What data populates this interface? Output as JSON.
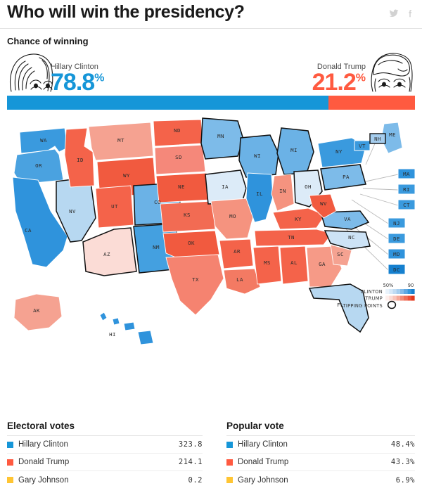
{
  "header": {
    "title": "Who will win the presidency?",
    "social": [
      {
        "name": "twitter-icon",
        "label": "Twitter"
      },
      {
        "name": "facebook-icon",
        "label": "Facebook"
      }
    ]
  },
  "chance": {
    "label": "Chance of winning",
    "clinton": {
      "name": "Hillary Clinton",
      "value": "78.8",
      "symbol": "%",
      "pct": 78.8,
      "color": "#1696d8"
    },
    "trump": {
      "name": "Donald Trump",
      "value": "21.2",
      "symbol": "%",
      "pct": 21.2,
      "color": "#ff5a40"
    }
  },
  "legend": {
    "scale_low": "50%",
    "scale_high": "90",
    "clinton_label": "CLINTON",
    "trump_label": "TRUMP",
    "tipping_label": "TIPPING POINTS",
    "clinton_ramp": [
      "#eaf3fb",
      "#d7e9f8",
      "#c0dcf3",
      "#a5cdee",
      "#84bbe8",
      "#5fa8e2",
      "#3596db",
      "#1680cf"
    ],
    "trump_ramp": [
      "#fdeeeb",
      "#fbdcd6",
      "#f9c5bb",
      "#f6a998",
      "#f38b77",
      "#f06f57",
      "#ed5138",
      "#e3381c"
    ]
  },
  "map": {
    "tipping_states": [
      "NV",
      "CO",
      "IA",
      "OH",
      "NC",
      "PA",
      "FL",
      "MN",
      "WI",
      "NH",
      "NM",
      "MI",
      "VA",
      "AZ"
    ],
    "states": [
      {
        "code": "WA",
        "color": "#3a9ade"
      },
      {
        "code": "OR",
        "color": "#4aa2e0"
      },
      {
        "code": "CA",
        "color": "#2f93dc"
      },
      {
        "code": "NV",
        "color": "#b7d8f1"
      },
      {
        "code": "ID",
        "color": "#f4634a"
      },
      {
        "code": "MT",
        "color": "#f5a291"
      },
      {
        "code": "WY",
        "color": "#f15a3f"
      },
      {
        "code": "UT",
        "color": "#f4634a"
      },
      {
        "code": "AZ",
        "color": "#fbdcd6"
      },
      {
        "code": "NM",
        "color": "#44a0e0"
      },
      {
        "code": "CO",
        "color": "#6bb2e6"
      },
      {
        "code": "ND",
        "color": "#f4634a"
      },
      {
        "code": "SD",
        "color": "#f5887a"
      },
      {
        "code": "NE",
        "color": "#f15a3f"
      },
      {
        "code": "KS",
        "color": "#f26b53"
      },
      {
        "code": "OK",
        "color": "#f15a3f"
      },
      {
        "code": "TX",
        "color": "#f58370"
      },
      {
        "code": "MN",
        "color": "#7dbbe9"
      },
      {
        "code": "IA",
        "color": "#dcebf8"
      },
      {
        "code": "MO",
        "color": "#f5937f"
      },
      {
        "code": "AR",
        "color": "#f4634a"
      },
      {
        "code": "LA",
        "color": "#f37a63"
      },
      {
        "code": "WI",
        "color": "#6bb2e6"
      },
      {
        "code": "IL",
        "color": "#2f93dc"
      },
      {
        "code": "MI",
        "color": "#6bb2e6"
      },
      {
        "code": "IN",
        "color": "#f5937f"
      },
      {
        "code": "OH",
        "color": "#dcebf8"
      },
      {
        "code": "KY",
        "color": "#f4634a"
      },
      {
        "code": "TN",
        "color": "#f4634a"
      },
      {
        "code": "MS",
        "color": "#f4634a"
      },
      {
        "code": "AL",
        "color": "#f4634a"
      },
      {
        "code": "GA",
        "color": "#f69a87"
      },
      {
        "code": "FL",
        "color": "#b7d8f1"
      },
      {
        "code": "SC",
        "color": "#f5a291"
      },
      {
        "code": "NC",
        "color": "#cde3f6"
      },
      {
        "code": "VA",
        "color": "#7dbbe9"
      },
      {
        "code": "WV",
        "color": "#f15a3f"
      },
      {
        "code": "PA",
        "color": "#7dbbe9"
      },
      {
        "code": "NY",
        "color": "#3a9ade"
      },
      {
        "code": "ME",
        "color": "#7dbbe9"
      },
      {
        "code": "AK",
        "color": "#f5a291"
      },
      {
        "code": "HI",
        "color": "#2f93dc"
      }
    ],
    "boxes": [
      {
        "code": "VT",
        "color": "#3a9ade"
      },
      {
        "code": "NH",
        "color": "#a5cdee"
      },
      {
        "code": "MA",
        "color": "#2f93dc"
      },
      {
        "code": "RI",
        "color": "#3a9ade"
      },
      {
        "code": "CT",
        "color": "#3a9ade"
      },
      {
        "code": "NJ",
        "color": "#3a9ade"
      },
      {
        "code": "DE",
        "color": "#3a9ade"
      },
      {
        "code": "MD",
        "color": "#2f93dc"
      },
      {
        "code": "DC",
        "color": "#1680cf"
      }
    ]
  },
  "electoral": {
    "title": "Electoral votes",
    "rows": [
      {
        "name": "Hillary Clinton",
        "value": "323.8",
        "color": "#1696d8"
      },
      {
        "name": "Donald Trump",
        "value": "214.1",
        "color": "#ff5a40"
      },
      {
        "name": "Gary Johnson",
        "value": "0.2",
        "color": "#ffc533"
      }
    ]
  },
  "popular": {
    "title": "Popular vote",
    "rows": [
      {
        "name": "Hillary Clinton",
        "value": "48.4%",
        "color": "#1696d8"
      },
      {
        "name": "Donald Trump",
        "value": "43.3%",
        "color": "#ff5a40"
      },
      {
        "name": "Gary Johnson",
        "value": "6.9%",
        "color": "#ffc533"
      }
    ]
  },
  "chart_data": {
    "type": "map",
    "title": "Who will win the presidency?",
    "series": [
      {
        "name": "Chance of winning",
        "categories": [
          "Hillary Clinton",
          "Donald Trump"
        ],
        "values": [
          78.8,
          21.2
        ],
        "unit": "%"
      },
      {
        "name": "Electoral votes",
        "categories": [
          "Hillary Clinton",
          "Donald Trump",
          "Gary Johnson"
        ],
        "values": [
          323.8,
          214.1,
          0.2
        ],
        "unit": ""
      },
      {
        "name": "Popular vote",
        "categories": [
          "Hillary Clinton",
          "Donald Trump",
          "Gary Johnson"
        ],
        "values": [
          48.4,
          43.3,
          6.9
        ],
        "unit": "%"
      }
    ],
    "legend_scale": {
      "min": "50%",
      "max": "90",
      "rows": [
        "CLINTON",
        "TRUMP",
        "TIPPING POINTS"
      ]
    }
  }
}
